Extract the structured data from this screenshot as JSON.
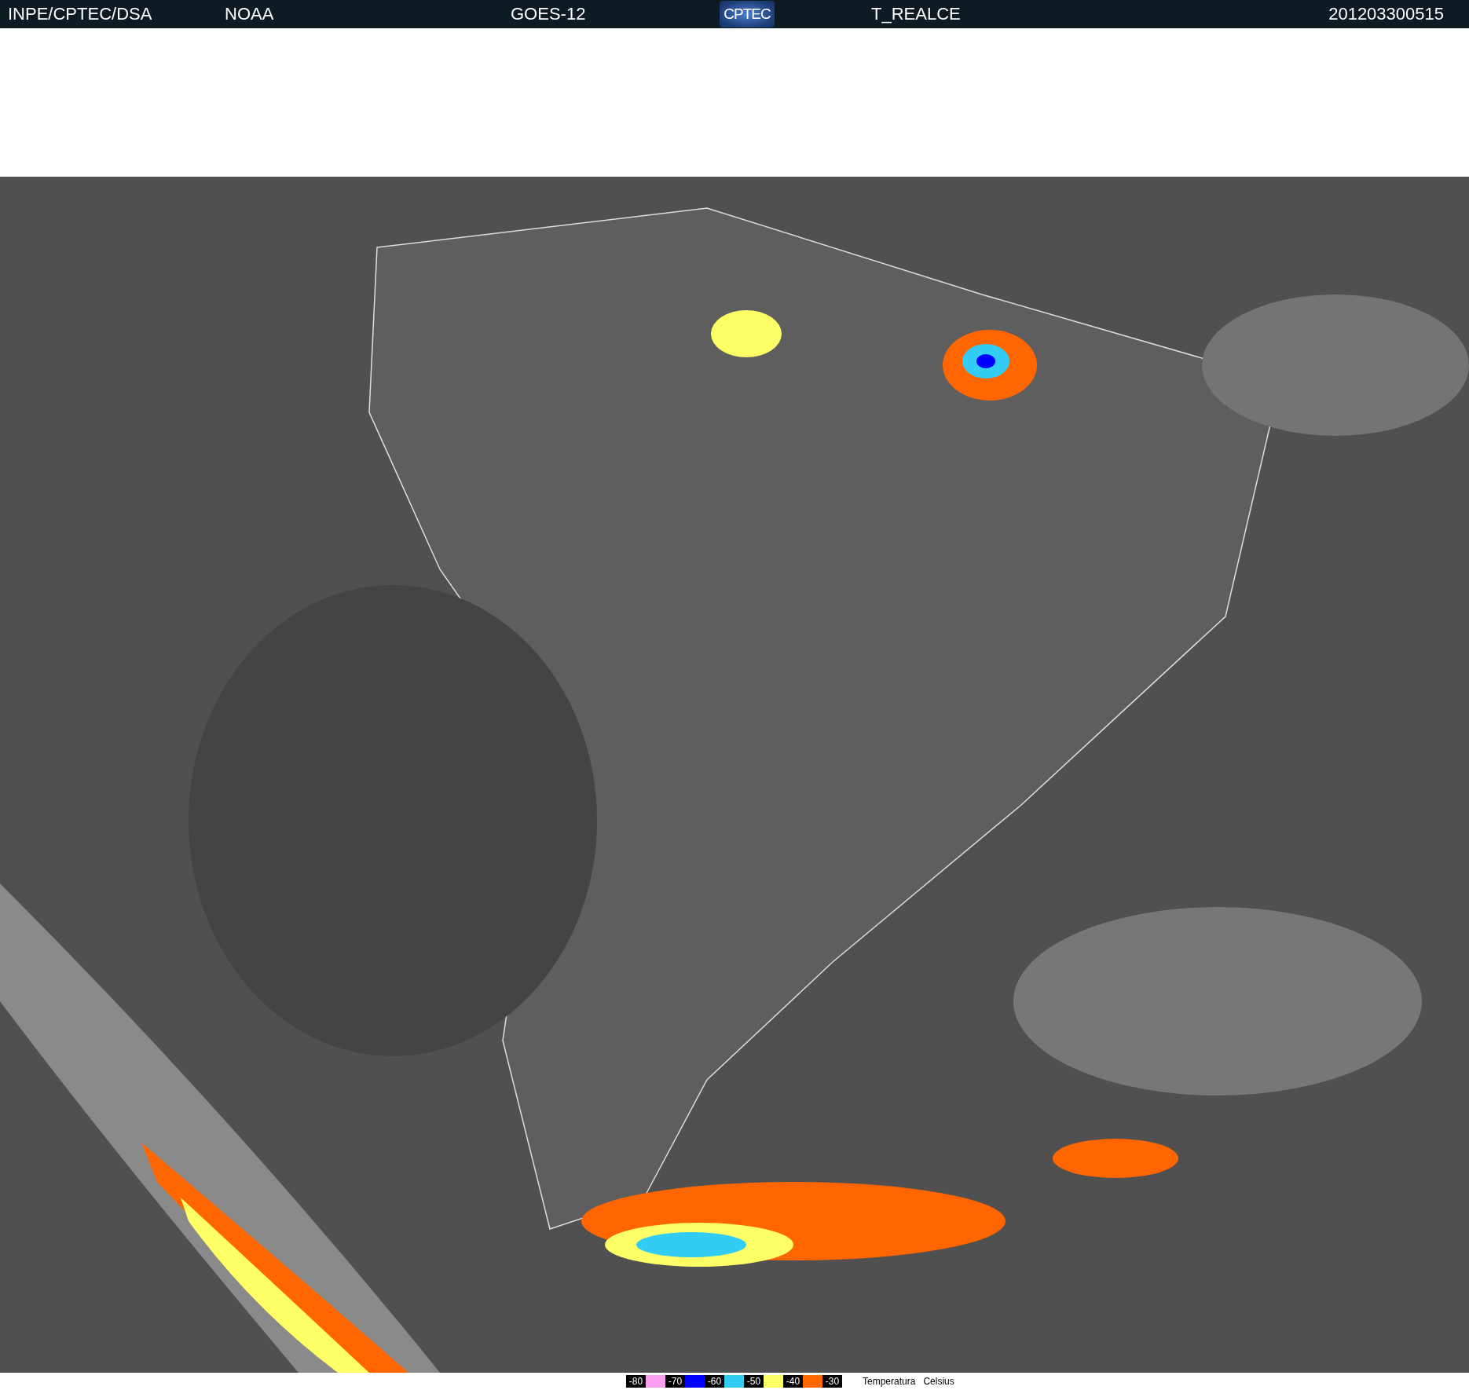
{
  "header": {
    "source": "INPE/CPTEC/DSA",
    "agency": "NOAA",
    "satellite": "GOES-12",
    "logo": "CPTEC",
    "product": "T_REALCE",
    "timestamp": "201203300515"
  },
  "legend": {
    "steps": [
      {
        "label": "-80",
        "color": "#f9a0f0"
      },
      {
        "label": "-70",
        "color": "#0000ff"
      },
      {
        "label": "-60",
        "color": "#33ccf5"
      },
      {
        "label": "-50",
        "color": "#ffff66"
      },
      {
        "label": "-40",
        "color": "#ff6600"
      },
      {
        "label": "-30"
      }
    ],
    "title": "Temperatura",
    "unit": "Celsius"
  }
}
